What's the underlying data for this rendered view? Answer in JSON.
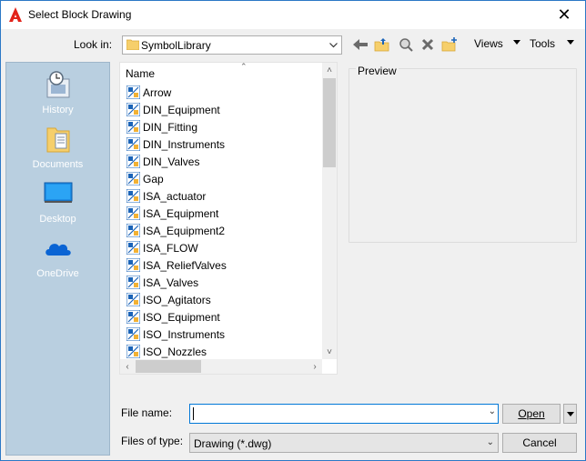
{
  "window": {
    "title": "Select Block Drawing"
  },
  "toolbar": {
    "lookin_label": "Look in:",
    "lookin_value": "SymbolLibrary",
    "views_label": "Views",
    "tools_label": "Tools"
  },
  "places": [
    {
      "label": "History",
      "icon": "history-icon"
    },
    {
      "label": "Documents",
      "icon": "documents-icon"
    },
    {
      "label": "Desktop",
      "icon": "desktop-icon"
    },
    {
      "label": "OneDrive",
      "icon": "onedrive-icon"
    }
  ],
  "filelist": {
    "column_name": "Name",
    "items": [
      "Arrow",
      "DIN_Equipment",
      "DIN_Fitting",
      "DIN_Instruments",
      "DIN_Valves",
      "Gap",
      "ISA_actuator",
      "ISA_Equipment",
      "ISA_Equipment2",
      "ISA_FLOW",
      "ISA_ReliefValves",
      "ISA_Valves",
      "ISO_Agitators",
      "ISO_Equipment",
      "ISO_Instruments",
      "ISO_Nozzles"
    ]
  },
  "preview": {
    "label": "Preview"
  },
  "form": {
    "file_name_label": "File name:",
    "file_name_value": "",
    "files_of_type_label": "Files of type:",
    "files_of_type_value": "Drawing (*.dwg)"
  },
  "buttons": {
    "open": "Open",
    "cancel": "Cancel"
  },
  "colors": {
    "accent": "#0078d7",
    "places_bg": "#b9cfe0"
  }
}
